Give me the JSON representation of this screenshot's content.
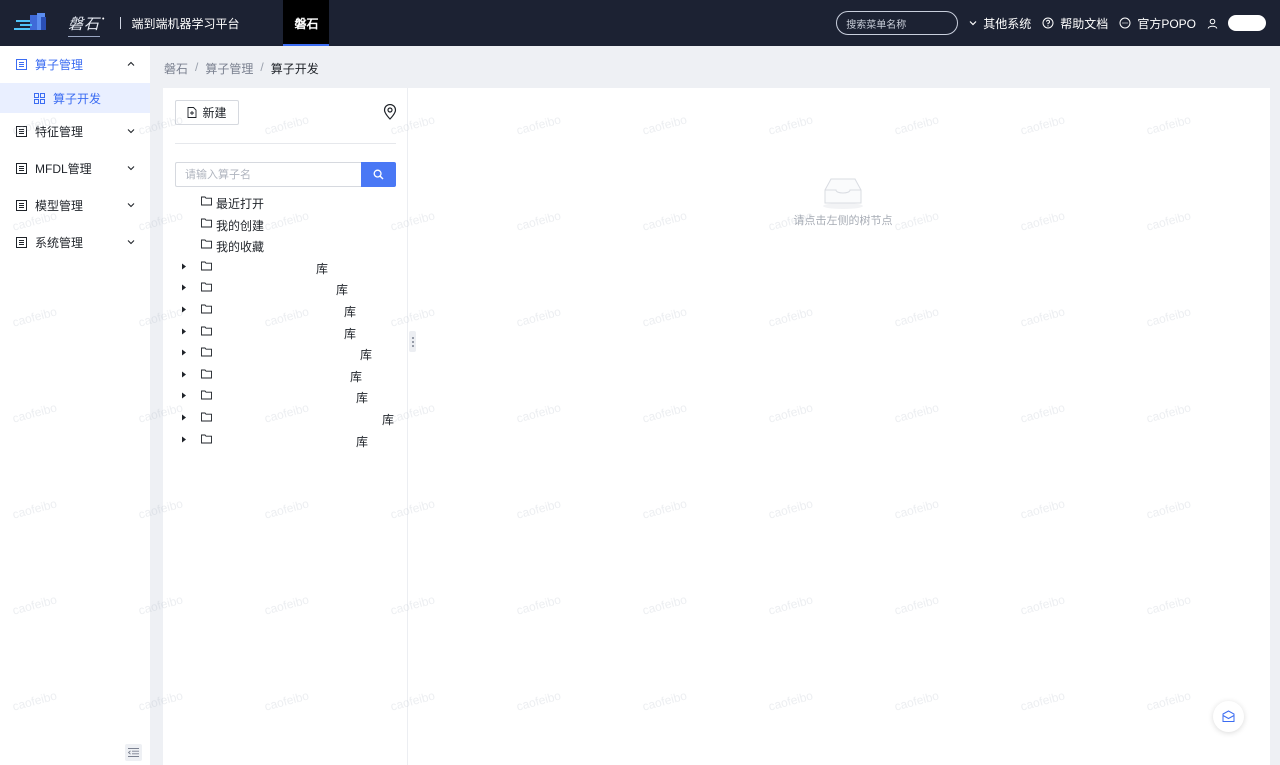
{
  "header": {
    "logo_text": "磐石",
    "platform_title": "端到端机器学习平台",
    "active_tab": "磐石",
    "menu_search_placeholder": "搜索菜单名称",
    "other_systems": "其他系统",
    "help_docs": "帮助文档",
    "popo": "官方POPO"
  },
  "sidebar": {
    "groups": [
      {
        "label": "算子管理",
        "expanded": true,
        "children": [
          {
            "label": "算子开发"
          }
        ]
      },
      {
        "label": "特征管理",
        "expanded": false
      },
      {
        "label": "MFDL管理",
        "expanded": false
      },
      {
        "label": "模型管理",
        "expanded": false
      },
      {
        "label": "系统管理",
        "expanded": false
      }
    ]
  },
  "breadcrumb": [
    "磐石",
    "算子管理",
    "算子开发"
  ],
  "tree_pane": {
    "new_button": "新建",
    "search_placeholder": "请输入算子名",
    "fixed_nodes": [
      "最近打开",
      "我的创建",
      "我的收藏"
    ],
    "library_nodes": [
      {
        "visible_text": "库"
      },
      {
        "visible_text": "库"
      },
      {
        "visible_text": "库"
      },
      {
        "visible_text": "库"
      },
      {
        "visible_text": "库"
      },
      {
        "visible_text": "库"
      },
      {
        "visible_text": "库"
      },
      {
        "visible_text": "库"
      },
      {
        "visible_text": "库"
      }
    ]
  },
  "content": {
    "empty_text": "请点击左侧的树节点"
  },
  "watermark": "caofeibo",
  "colors": {
    "accent": "#3b6cf2",
    "topbar": "#1c2233",
    "search_button": "#4a78f5"
  }
}
